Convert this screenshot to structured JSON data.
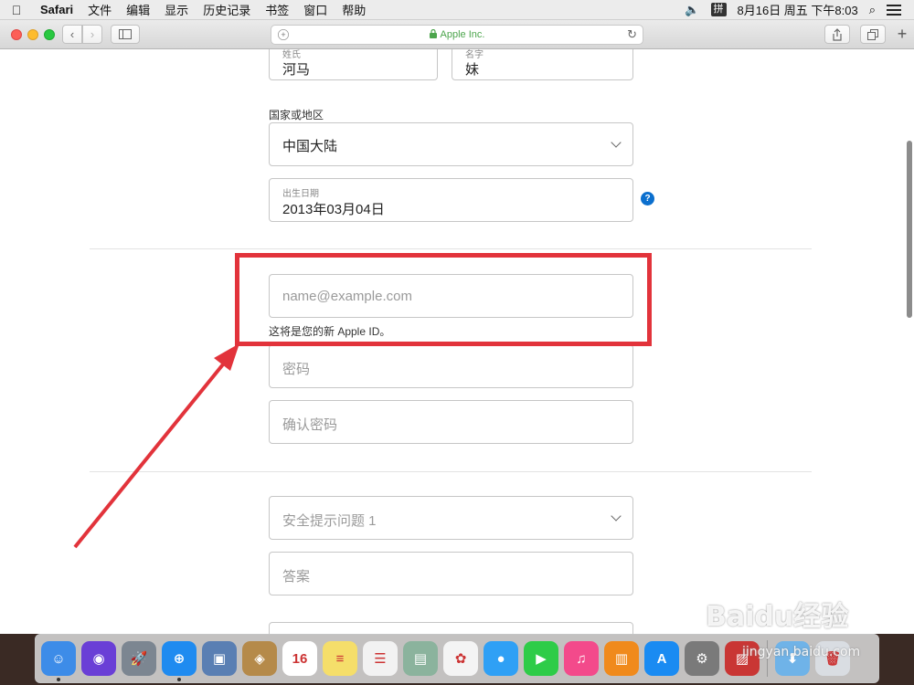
{
  "menubar": {
    "app": "Safari",
    "items": [
      "文件",
      "编辑",
      "显示",
      "历史记录",
      "书签",
      "窗口",
      "帮助"
    ],
    "ime": "拼",
    "clock": "8月16日 周五 下午8:03"
  },
  "browser": {
    "address": "Apple Inc."
  },
  "form": {
    "last_name_label": "姓氏",
    "last_name_value": "河马",
    "first_name_label": "名字",
    "first_name_value": "妹",
    "country_section_label": "国家或地区",
    "country_value": "中国大陆",
    "birthday_label": "出生日期",
    "birthday_value": "2013年03月04日",
    "help_glyph": "?",
    "email_placeholder": "name@example.com",
    "email_hint": "这将是您的新 Apple ID。",
    "password_placeholder": "密码",
    "confirm_password_placeholder": "确认密码",
    "security_question_placeholder": "安全提示问题 1",
    "answer_placeholder": "答案"
  },
  "annotation": {
    "color": "#e2333b"
  },
  "dock": {
    "apps": [
      {
        "name": "finder-icon",
        "color": "#3d8ce8",
        "glyph": "☺"
      },
      {
        "name": "siri-icon",
        "color": "#6a3fd6",
        "glyph": "◉"
      },
      {
        "name": "launchpad-icon",
        "color": "#7c8691",
        "glyph": "🚀"
      },
      {
        "name": "safari-icon",
        "color": "#1f8bf0",
        "glyph": "⊕"
      },
      {
        "name": "preview-icon",
        "color": "#5a7fb3",
        "glyph": "▣"
      },
      {
        "name": "contacts-icon",
        "color": "#b58a4a",
        "glyph": "◈"
      },
      {
        "name": "calendar-icon",
        "color": "#ffffff",
        "glyph": "16"
      },
      {
        "name": "notes-icon",
        "color": "#f5de6a",
        "glyph": "≡"
      },
      {
        "name": "reminders-icon",
        "color": "#f2f2f2",
        "glyph": "☰"
      },
      {
        "name": "photo-booth-icon",
        "color": "#8bb39d",
        "glyph": "▤"
      },
      {
        "name": "photos-icon",
        "color": "#f4f4f4",
        "glyph": "✿"
      },
      {
        "name": "messages-icon",
        "color": "#2fa0f5",
        "glyph": "●"
      },
      {
        "name": "facetime-icon",
        "color": "#2ecc48",
        "glyph": "▶"
      },
      {
        "name": "itunes-icon",
        "color": "#f34a8b",
        "glyph": "♫"
      },
      {
        "name": "ibooks-icon",
        "color": "#f08a1c",
        "glyph": "▥"
      },
      {
        "name": "app-store-icon",
        "color": "#1a8bf2",
        "glyph": "A"
      },
      {
        "name": "system-preferences-icon",
        "color": "#7a7a7a",
        "glyph": "⚙"
      },
      {
        "name": "parallels-icon",
        "color": "#c93634",
        "glyph": "▨"
      }
    ],
    "trailing": [
      {
        "name": "downloads-icon",
        "color": "#6fb3e8",
        "glyph": "⬇"
      },
      {
        "name": "trash-icon",
        "color": "#d9dde2",
        "glyph": "🗑"
      }
    ]
  },
  "watermark": {
    "brand": "Baidu经验",
    "url": "jingyan.baidu.com"
  }
}
